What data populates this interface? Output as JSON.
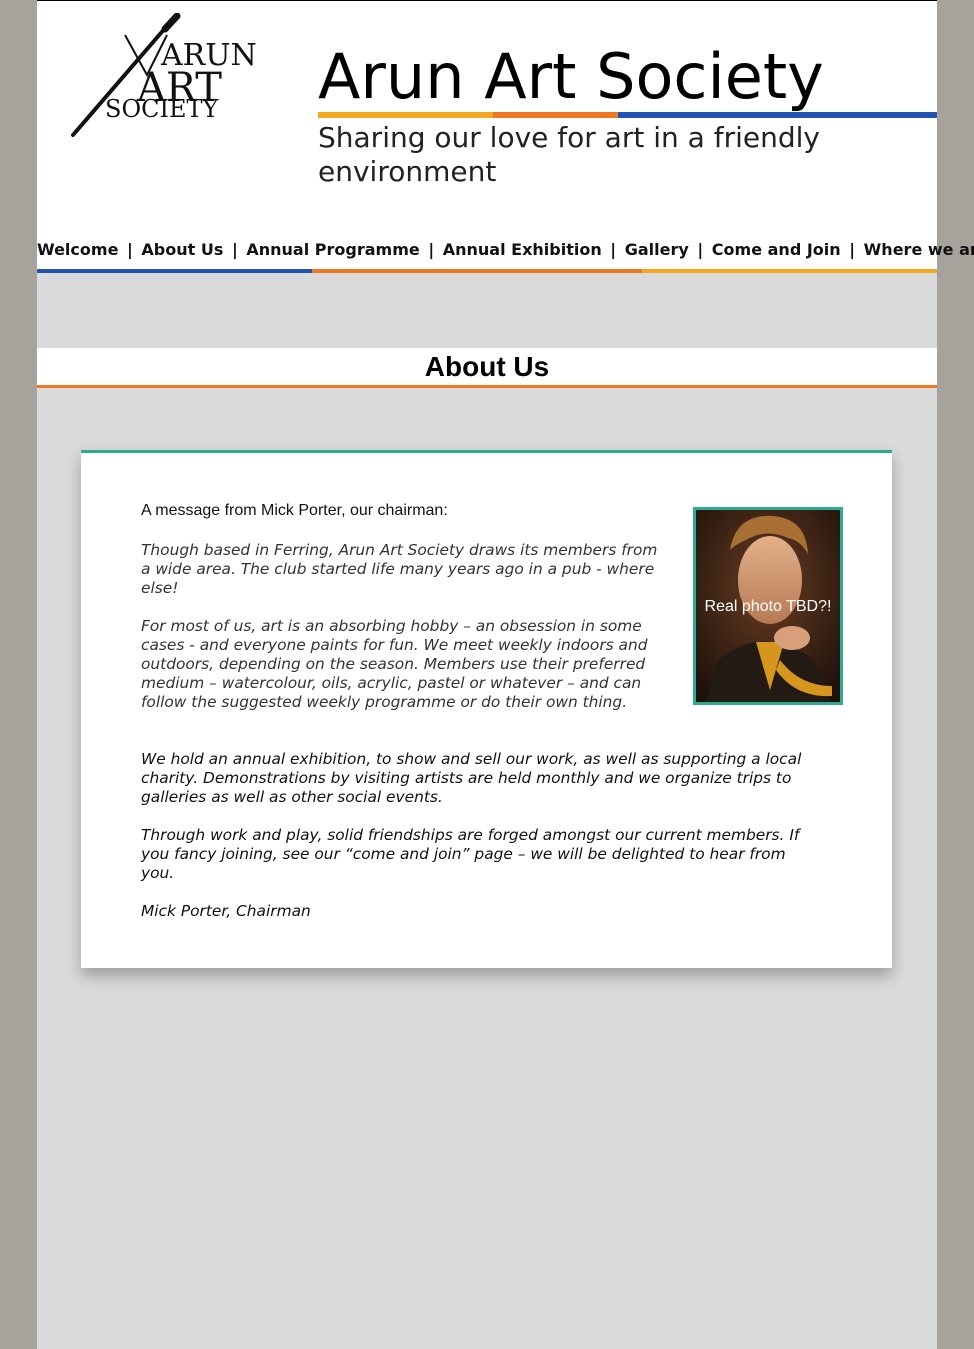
{
  "header": {
    "logo_text": [
      "ARUN",
      "ART",
      "SOCIETY"
    ],
    "title": "Arun Art Society",
    "tagline": "Sharing our love for art in a friendly environment"
  },
  "nav": {
    "items": [
      {
        "label": "Welcome"
      },
      {
        "label": "About Us"
      },
      {
        "label": "Annual Programme"
      },
      {
        "label": "Annual Exhibition"
      },
      {
        "label": "Gallery"
      },
      {
        "label": "Come and Join"
      },
      {
        "label": "Where we are"
      }
    ],
    "separator": "|"
  },
  "page": {
    "section_title": "About Us"
  },
  "content": {
    "intro": "A message from Mick Porter, our chairman:",
    "paragraphs": [
      "Though based in Ferring, Arun Art Society draws its members from a wide area. The club started life many years ago in a pub - where else!",
      "For most of us, art is an absorbing hobby – an obsession in some cases - and everyone paints for fun. We meet weekly indoors and outdoors, depending on the season. Members use their preferred medium – watercolour, oils, acrylic, pastel or whatever – and can follow the suggested weekly programme or do their own thing.",
      "We hold an annual exhibition, to show and sell our work, as well as supporting a local charity. Demonstrations by visiting artists are held monthly and we organize trips to galleries as well as other social events.",
      "Through work and play, solid friendships are forged amongst our current members. If you fancy joining, see our “come and join” page – we will be delighted to hear from you.",
      "Mick Porter, Chairman"
    ],
    "photo_caption": "Real photo TBD?!"
  },
  "colors": {
    "accent_yellow": "#f4a81d",
    "accent_orange": "#ee7722",
    "accent_blue": "#2054b0",
    "accent_teal": "#2eaa90",
    "page_bg": "#dadada",
    "outer_bg": "#a8a29c"
  }
}
